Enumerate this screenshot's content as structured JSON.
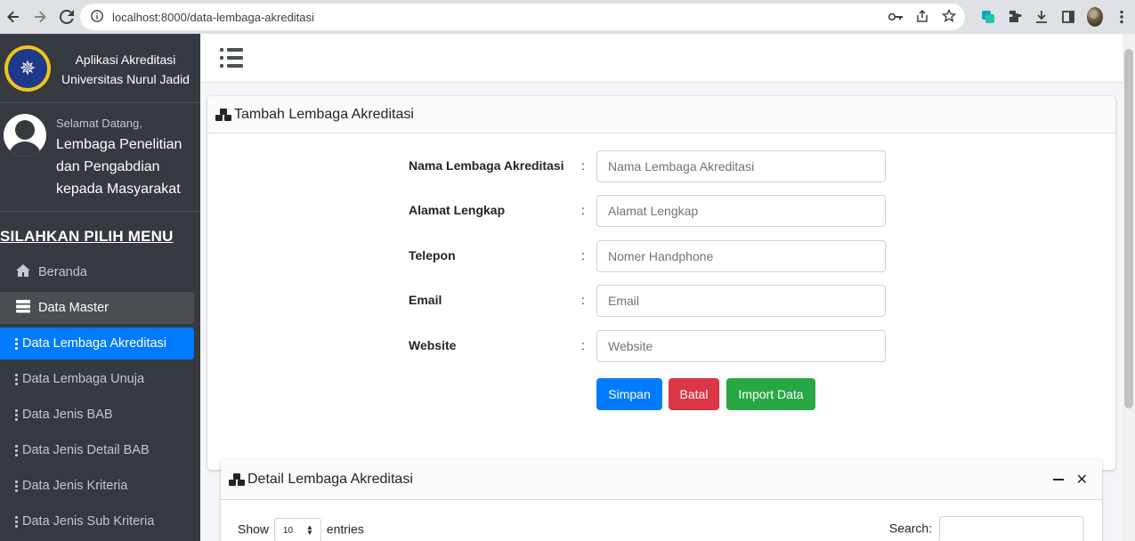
{
  "browser": {
    "url": "localhost:8000/data-lembaga-akreditasi"
  },
  "sidebar": {
    "brand_line1": "Aplikasi Akreditasi",
    "brand_line2": "Universitas Nurul Jadid",
    "welcome": "Selamat Datang,",
    "user_line1": "Lembaga Penelitian",
    "user_line2": "dan Pengabdian",
    "user_line3": "kepada Masyarakat",
    "menu_header": "SILAHKAN PILIH MENU",
    "items": [
      {
        "label": "Beranda",
        "icon": "home-icon"
      },
      {
        "label": "Data Master",
        "icon": "database-icon"
      },
      {
        "label": "Data Lembaga Akreditasi",
        "icon": "dots-icon"
      },
      {
        "label": "Data Lembaga Unuja",
        "icon": "dots-icon"
      },
      {
        "label": "Data Jenis BAB",
        "icon": "dots-icon"
      },
      {
        "label": "Data Jenis Detail BAB",
        "icon": "dots-icon"
      },
      {
        "label": "Data Jenis Kriteria",
        "icon": "dots-icon"
      },
      {
        "label": "Data Jenis Sub Kriteria",
        "icon": "dots-icon"
      }
    ]
  },
  "form_card": {
    "title": "Tambah Lembaga Akreditasi",
    "fields": [
      {
        "label": "Nama Lembaga Akreditasi",
        "placeholder": "Nama Lembaga Akreditasi"
      },
      {
        "label": "Alamat Lengkap",
        "placeholder": "Alamat Lengkap"
      },
      {
        "label": "Telepon",
        "placeholder": "Nomer Handphone"
      },
      {
        "label": "Email",
        "placeholder": "Email"
      },
      {
        "label": "Website",
        "placeholder": "Website"
      }
    ],
    "colon": ":",
    "buttons": {
      "save": "Simpan",
      "cancel": "Batal",
      "import": "Import Data"
    }
  },
  "detail_card": {
    "title": "Detail Lembaga Akreditasi",
    "show_label": "Show",
    "entries_value": "10",
    "entries_label": "entries",
    "search_label": "Search:"
  },
  "colors": {
    "primary": "#007bff",
    "danger": "#dc3545",
    "success": "#28a745",
    "sidebar_bg": "#343a40"
  }
}
